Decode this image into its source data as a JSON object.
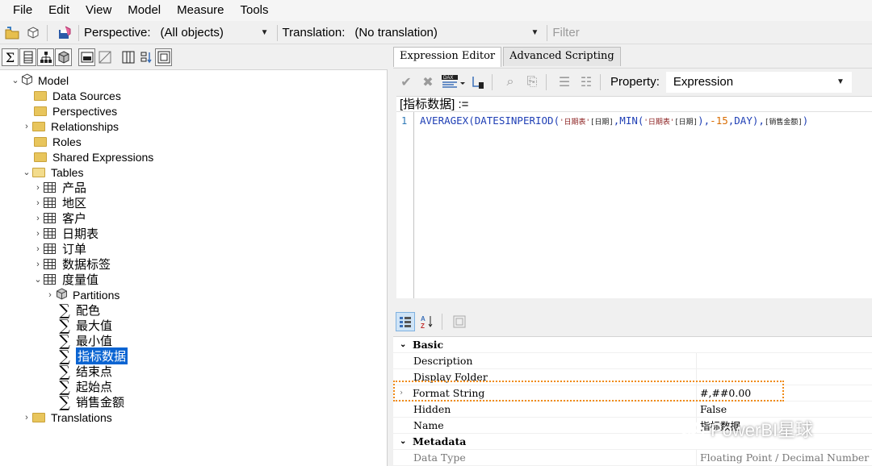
{
  "menu": [
    "File",
    "Edit",
    "View",
    "Model",
    "Measure",
    "Tools"
  ],
  "toolbar": {
    "perspective_label": "Perspective:",
    "perspective_value": "(All objects)",
    "translation_label": "Translation:",
    "translation_value": "(No translation)",
    "filter_placeholder": "Filter"
  },
  "tree": {
    "model": "Model",
    "data_sources": "Data Sources",
    "perspectives": "Perspectives",
    "relationships": "Relationships",
    "roles": "Roles",
    "shared_expressions": "Shared Expressions",
    "tables": "Tables",
    "table_items": [
      "产品",
      "地区",
      "客户",
      "日期表",
      "订单",
      "数据标签",
      "度量值"
    ],
    "partitions": "Partitions",
    "measures": [
      "配色",
      "最大值",
      "最小值",
      "指标数据",
      "结束点",
      "起始点",
      "销售金额"
    ],
    "selected_measure": "指标数据",
    "translations": "Translations"
  },
  "editor": {
    "tabs": [
      "Expression Editor",
      "Advanced Scripting"
    ],
    "active_tab": "Expression Editor",
    "property_label": "Property:",
    "property_value": "Expression",
    "measure_header": "[指标数据] :=",
    "line_number": "1",
    "code": {
      "fn1": "AVERAGEX(",
      "fn2": "DATESINPERIOD(",
      "str1": "'日期表'",
      "col1": "[日期]",
      "fn3": ",MIN(",
      "str2": "'日期表'",
      "col2": "[日期]",
      "p1": "),",
      "num": "-15",
      "p2": ",DAY),",
      "col3": "[销售金额]",
      "p3": ")"
    }
  },
  "properties": {
    "basic_header": "Basic",
    "rows": [
      {
        "name": "Description",
        "value": ""
      },
      {
        "name": "Display Folder",
        "value": ""
      },
      {
        "name": "Format String",
        "value": "#,##0.00"
      },
      {
        "name": "Hidden",
        "value": "False"
      },
      {
        "name": "Name",
        "value": "指标数据"
      }
    ],
    "metadata_header": "Metadata",
    "metadata_rows": [
      {
        "name": "Data Type",
        "value": "Floating Point / Decimal Number"
      }
    ]
  },
  "watermark": "PowerBI星球",
  "colors": {
    "selection": "#0a64d2",
    "highlight": "#f08a14",
    "keyword": "#1f3fb5"
  }
}
